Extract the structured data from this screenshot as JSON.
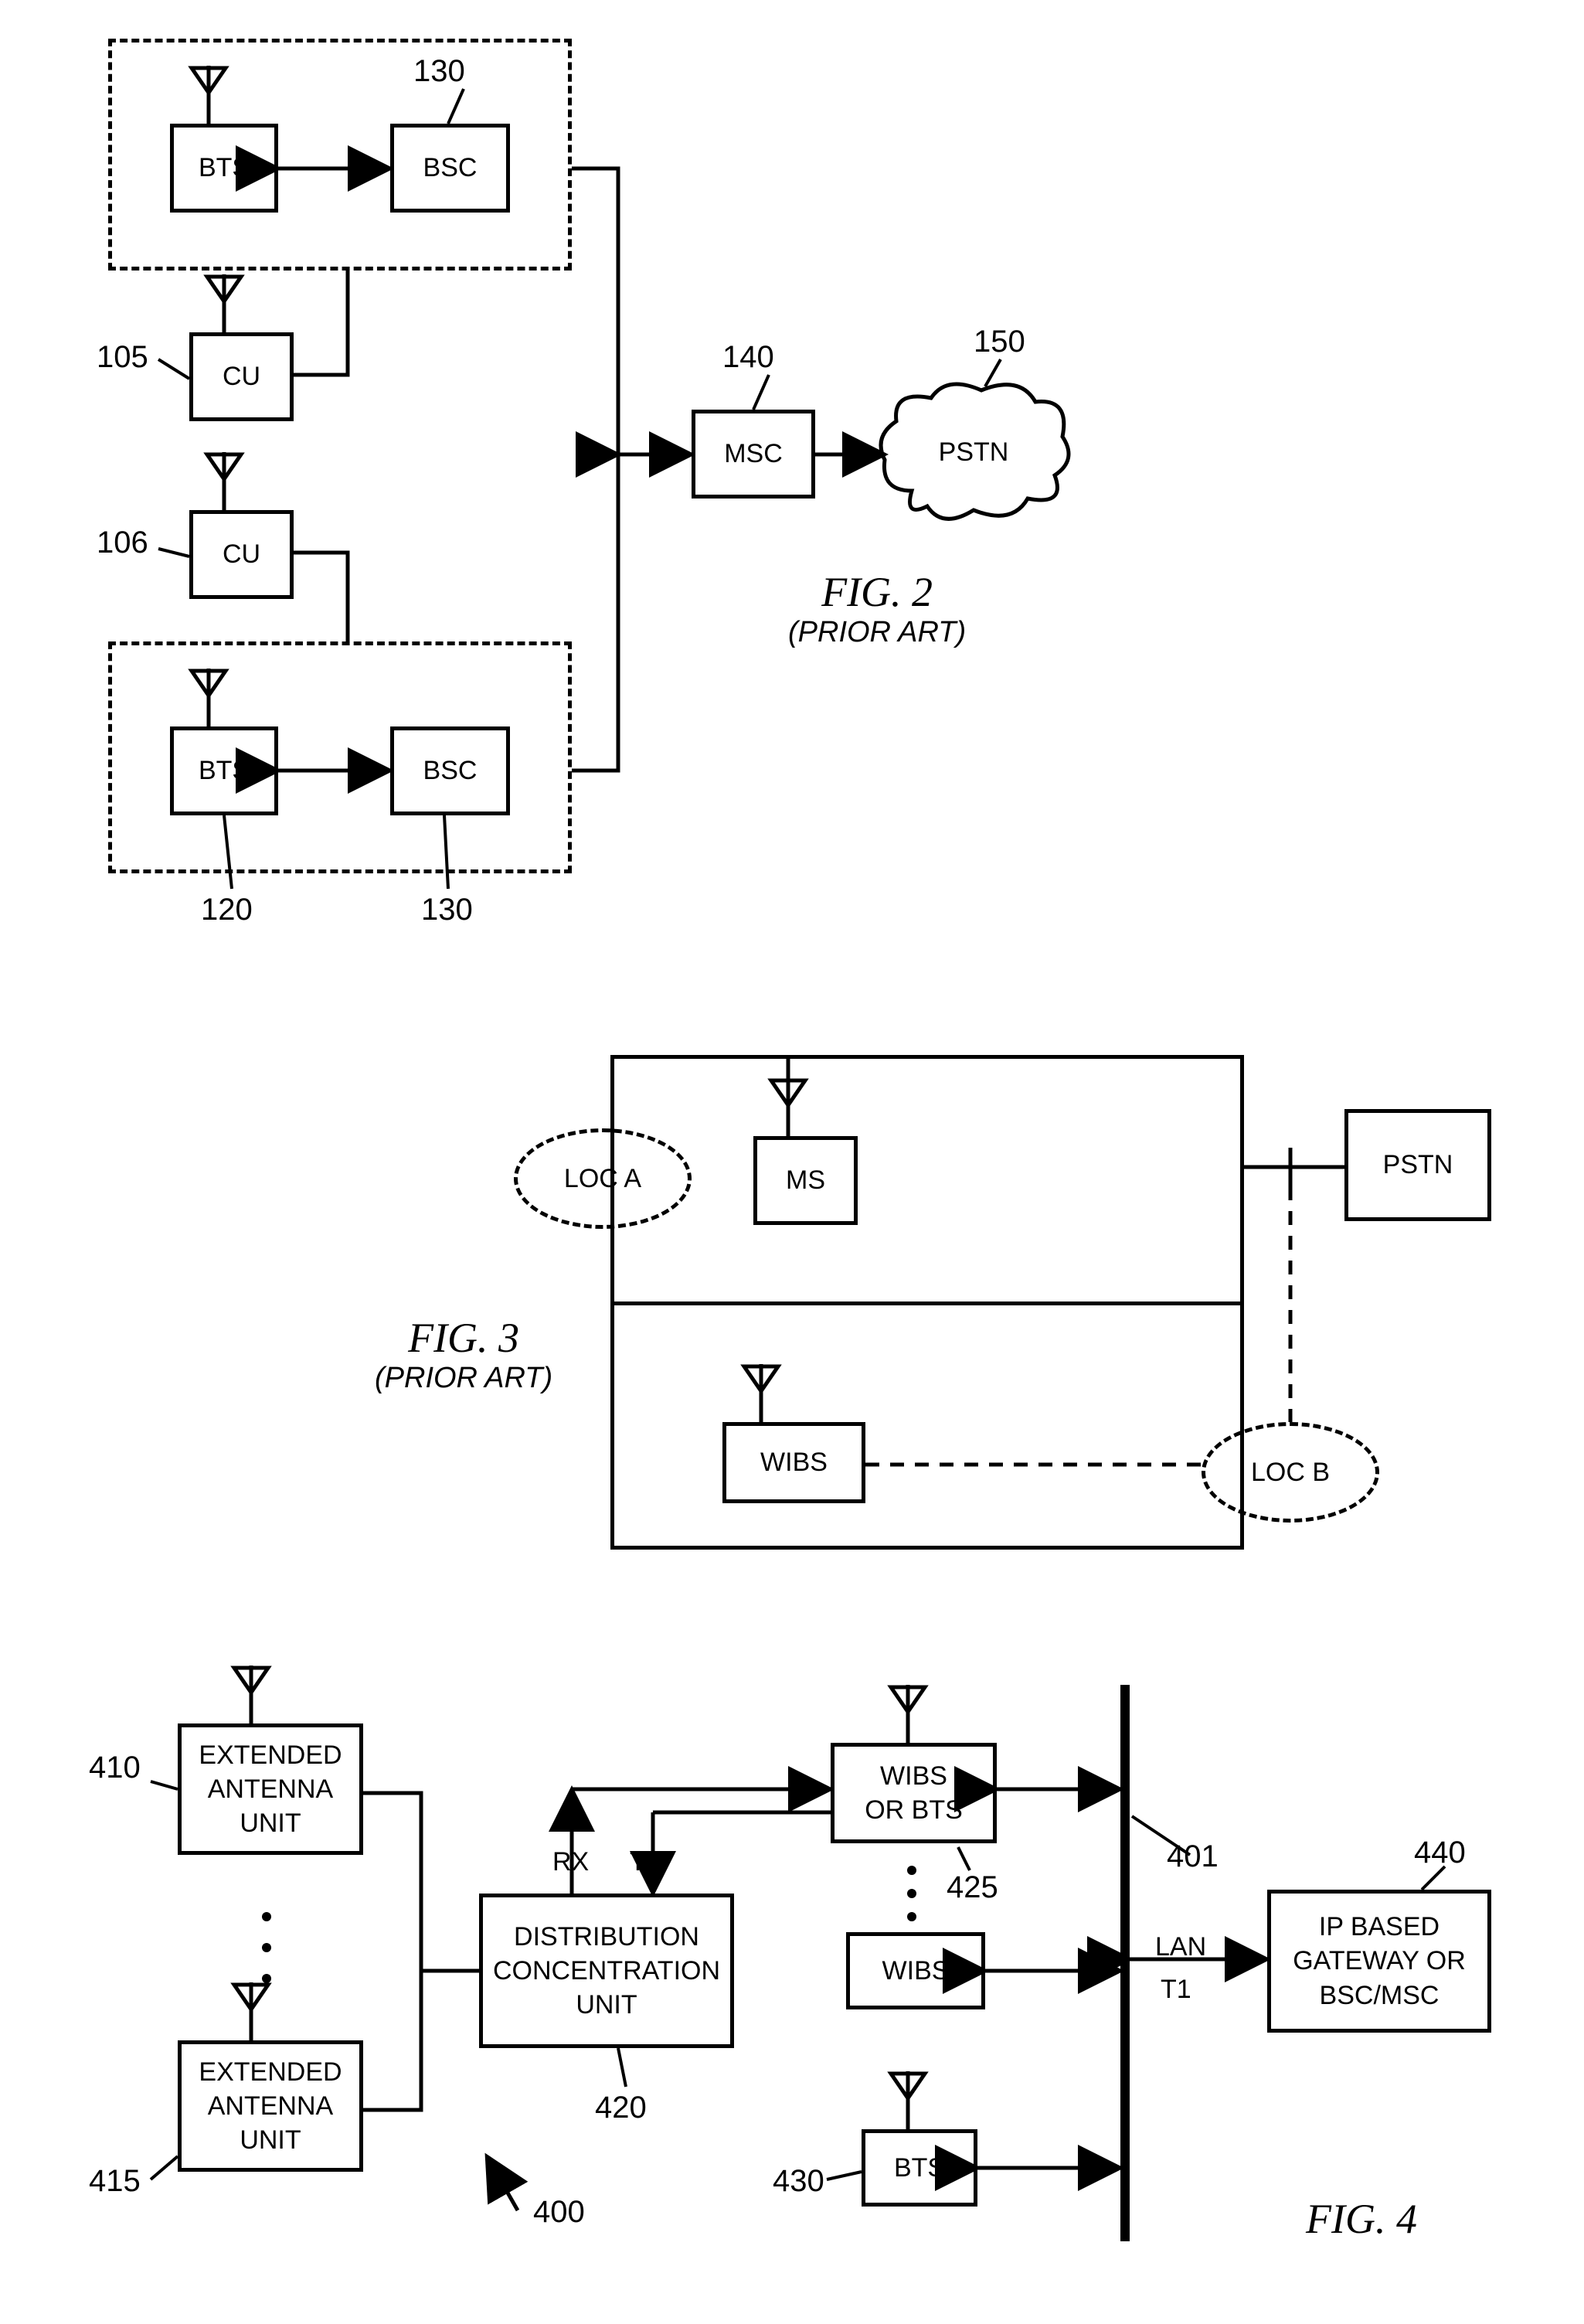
{
  "fig2": {
    "caption": "FIG. 2",
    "subcaption": "(PRIOR ART)",
    "bts_top": "BTS",
    "bsc_top": "BSC",
    "cu_top": "CU",
    "cu_bot": "CU",
    "bts_bot": "BTS",
    "bsc_bot": "BSC",
    "msc": "MSC",
    "pstn": "PSTN",
    "r105": "105",
    "r106": "106",
    "r120": "120",
    "r130a": "130",
    "r130b": "130",
    "r140": "140",
    "r150": "150"
  },
  "fig3": {
    "caption": "FIG. 3",
    "subcaption": "(PRIOR ART)",
    "loc_a": "LOC A",
    "loc_b": "LOC B",
    "ms": "MS",
    "wibs": "WIBS",
    "pstn": "PSTN"
  },
  "fig4": {
    "caption": "FIG. 4",
    "eau": "EXTENDED\nANTENNA\nUNIT",
    "dcu": "DISTRIBUTION\nCONCENTRATION\nUNIT",
    "wibs_bts": "WIBS\nOR BTS",
    "wibs": "WIBS",
    "bts": "BTS",
    "gateway": "IP BASED\nGATEWAY OR\nBSC/MSC",
    "rx": "RX",
    "tx": "TX",
    "lan": "LAN",
    "t1": "T1",
    "r400": "400",
    "r401": "401",
    "r410": "410",
    "r415": "415",
    "r420": "420",
    "r425": "425",
    "r430": "430",
    "r440": "440"
  }
}
